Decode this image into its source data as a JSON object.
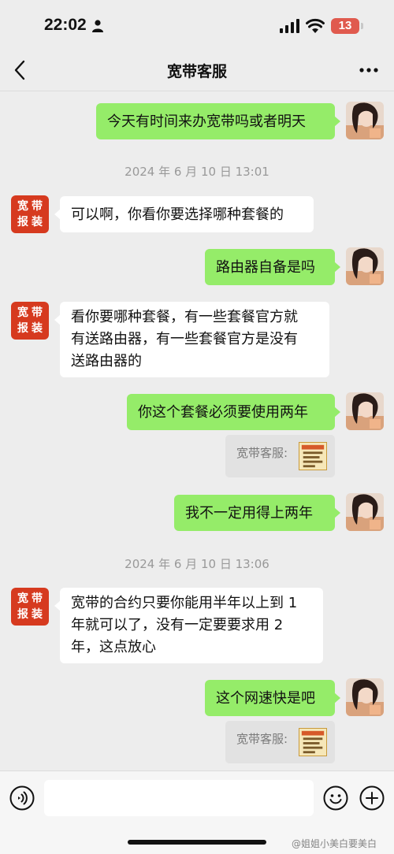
{
  "status_bar": {
    "time": "22:02",
    "battery": "13"
  },
  "header": {
    "title": "宽带客服"
  },
  "service_avatar": {
    "line1": "宽带",
    "line2": "报装"
  },
  "messages": [
    {
      "text": "今天有时间来办宽带吗或者明天"
    },
    {
      "timestamp": "2024 年 6 月 10 日 13:01"
    },
    {
      "text": "可以啊，你看你要选择哪种套餐的"
    },
    {
      "text": "路由器自备是吗"
    },
    {
      "line1": "看你要哪种套餐，有一些套餐官方就",
      "line2": "有送路由器，有一些套餐官方是没有",
      "line3": "送路由器的"
    },
    {
      "text": "你这个套餐必须要使用两年"
    },
    {
      "quote_label": "宽带客服:"
    },
    {
      "text": "我不一定用得上两年"
    },
    {
      "timestamp": "2024 年 6 月 10 日 13:06"
    },
    {
      "line1": "宽带的合约只要你能用半年以上到 1",
      "line2": "年就可以了，没有一定要要求用 2",
      "line3": "年，这点放心"
    },
    {
      "text": "这个网速快是吧"
    },
    {
      "quote_label": "宽带客服:"
    }
  ],
  "watermark": "@姐姐小美白要美白",
  "colors": {
    "outgoing_bubble": "#95ec69",
    "incoming_bubble": "#ffffff",
    "service_avatar": "#d63a1f",
    "background": "#ededed"
  }
}
